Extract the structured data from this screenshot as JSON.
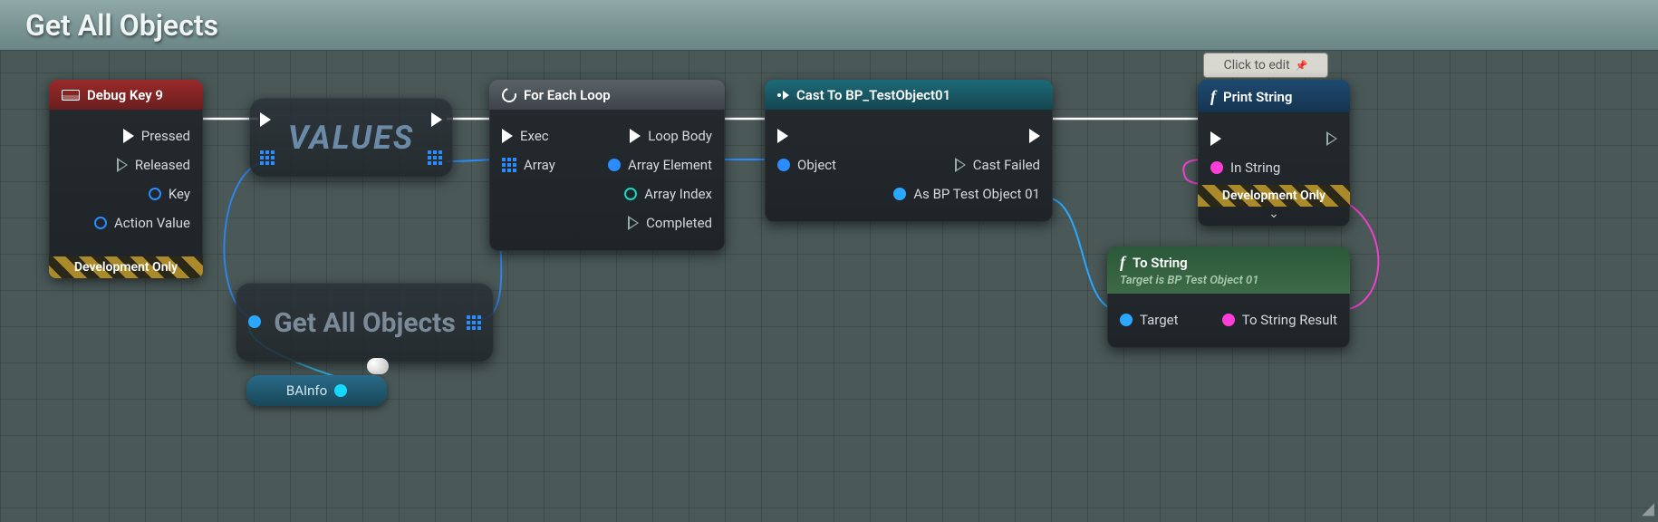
{
  "graph": {
    "title": "Get All Objects",
    "comment_hint": "Click to edit"
  },
  "nodes": {
    "debug_key": {
      "title": "Debug Key 9",
      "pins": {
        "pressed": "Pressed",
        "released": "Released",
        "key": "Key",
        "action_value": "Action Value"
      },
      "badge": "Development Only"
    },
    "values_macro": {
      "title": "VALUES"
    },
    "get_all_objects": {
      "title": "Get All Objects"
    },
    "bainfo": {
      "label": "BAInfo"
    },
    "foreach": {
      "title": "For Each Loop",
      "pins": {
        "exec": "Exec",
        "array": "Array",
        "loop_body": "Loop Body",
        "array_element": "Array Element",
        "array_index": "Array Index",
        "completed": "Completed"
      }
    },
    "cast": {
      "title": "Cast To BP_TestObject01",
      "pins": {
        "object": "Object",
        "cast_failed": "Cast Failed",
        "as_result": "As BP Test Object 01"
      }
    },
    "print": {
      "title": "Print String",
      "pins": {
        "in_string": "In String"
      },
      "badge": "Development Only"
    },
    "tostring": {
      "title": "To String",
      "subtitle": "Target is BP Test Object 01",
      "pins": {
        "target": "Target",
        "result": "To String Result"
      }
    }
  }
}
